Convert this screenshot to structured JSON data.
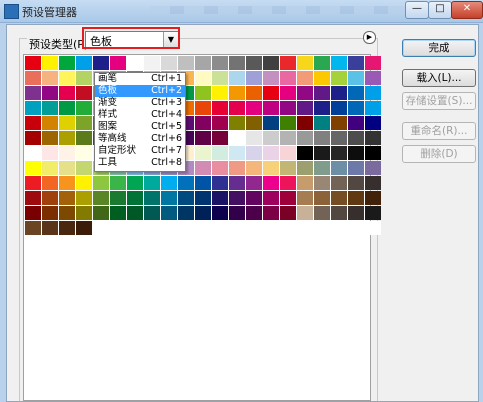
{
  "window": {
    "title": "预设管理器"
  },
  "group": {
    "label": "预设类型(P):"
  },
  "type_select": {
    "value": "色板"
  },
  "dropdown": {
    "items": [
      {
        "label": "画笔",
        "shortcut": "Ctrl+1"
      },
      {
        "label": "色板",
        "shortcut": "Ctrl+2",
        "selected": true
      },
      {
        "label": "渐变",
        "shortcut": "Ctrl+3"
      },
      {
        "label": "样式",
        "shortcut": "Ctrl+4"
      },
      {
        "label": "图案",
        "shortcut": "Ctrl+5"
      },
      {
        "label": "等高线",
        "shortcut": "Ctrl+6"
      },
      {
        "label": "自定形状",
        "shortcut": "Ctrl+7"
      },
      {
        "label": "工具",
        "shortcut": "Ctrl+8"
      }
    ]
  },
  "buttons": {
    "done": "完成",
    "load": "载入(L)...",
    "save": "存储设置(S)...",
    "rename": "重命名(R)...",
    "delete": "删除(D)"
  },
  "swatches": [
    "#e60012",
    "#fff100",
    "#00a73c",
    "#00a0e9",
    "#1d2088",
    "#e4007f",
    "#ffffff",
    "#f2f2f2",
    "#d9d9d9",
    "#bfbfbf",
    "#a6a6a6",
    "#8c8c8c",
    "#737373",
    "#595959",
    "#404040",
    "#e8282b",
    "#f7d71c",
    "#29a851",
    "#00b7ee",
    "#3b3f9c",
    "#e61673",
    "#ea6f5a",
    "#f6b37f",
    "#fff45c",
    "#b3d465",
    "#7ecef4",
    "#8c97cb",
    "#ae5da1",
    "#f19ec2",
    "#f19149",
    "#f8b551",
    "#fffac2",
    "#cce198",
    "#acd6ec",
    "#a0a0d8",
    "#c490bf",
    "#ea68a2",
    "#f29b76",
    "#fcc800",
    "#a5d13a",
    "#5bc2e7",
    "#9b59b6",
    "#7e318e",
    "#920783",
    "#e5004f",
    "#c30d23",
    "#b28850",
    "#8f8f8f",
    "#2e3192",
    "#0068b7",
    "#00a0c1",
    "#009944",
    "#8fc31f",
    "#fff100",
    "#f39800",
    "#eb6100",
    "#e60012",
    "#e4007f",
    "#920783",
    "#601986",
    "#1d2088",
    "#0068b7",
    "#00a0e9",
    "#00a0c1",
    "#009e96",
    "#009944",
    "#22ac38",
    "#8fc31f",
    "#cfdb00",
    "#fff100",
    "#f8b62d",
    "#f39800",
    "#ed6d00",
    "#e94709",
    "#e60033",
    "#e5004f",
    "#e4007f",
    "#be0081",
    "#920783",
    "#601986",
    "#1d2088",
    "#004098",
    "#0068b7",
    "#00a0e9",
    "#c7000b",
    "#d28300",
    "#dfd000",
    "#7ba428",
    "#00913a",
    "#008b84",
    "#0086ae",
    "#00479d",
    "#1b1464",
    "#5e0c73",
    "#810060",
    "#a1004e",
    "#808000",
    "#806000",
    "#004080",
    "#408000",
    "#800000",
    "#008080",
    "#804000",
    "#400080",
    "#000080",
    "#a40000",
    "#9d6500",
    "#aba000",
    "#5b7b1a",
    "#006d2c",
    "#006763",
    "#006482",
    "#003375",
    "#0d0a45",
    "#470456",
    "#600046",
    "#780038",
    "#ffffff",
    "#e6e6e6",
    "#cccccc",
    "#b3b3b3",
    "#999999",
    "#808080",
    "#666666",
    "#4d4d4d",
    "#333333",
    "#ffffff",
    "#ffe6e6",
    "#fff2e6",
    "#ffffe6",
    "#e6ffe6",
    "#e6ffff",
    "#e6e6ff",
    "#ffe6ff",
    "#fde2c3",
    "#fcf0ce",
    "#eaf4cf",
    "#d2ecdf",
    "#d0e8f1",
    "#d7d3ea",
    "#ead2e7",
    "#f6d4d8",
    "#000000",
    "#1a1a1a",
    "#262626",
    "#0d0d0d",
    "#000000",
    "#ffff00",
    "#f1ed6a",
    "#e5e089",
    "#c4d66f",
    "#a4cc6b",
    "#8bc4ad",
    "#85bde3",
    "#8ba5d6",
    "#9a8fc6",
    "#b18bc1",
    "#d28cb4",
    "#e88ea0",
    "#ee9a85",
    "#f4b67b",
    "#f7d07a",
    "#c3b574",
    "#9ca06f",
    "#7f9c8c",
    "#6d8fa5",
    "#6d79a8",
    "#7a6a9e",
    "#ed1c24",
    "#f26522",
    "#f7941d",
    "#fff200",
    "#8dc63f",
    "#39b54a",
    "#00a651",
    "#00a99d",
    "#00aeef",
    "#0072bc",
    "#0054a6",
    "#2e3192",
    "#662d91",
    "#92278f",
    "#ec008c",
    "#ed145b",
    "#c69c6d",
    "#998675",
    "#736357",
    "#534741",
    "#362f2d",
    "#9e0b0f",
    "#a0410d",
    "#a36209",
    "#aba000",
    "#598527",
    "#1a7b30",
    "#007236",
    "#00746b",
    "#0076a3",
    "#004a80",
    "#003471",
    "#1b1464",
    "#440e62",
    "#630460",
    "#9e005d",
    "#9e0039",
    "#a67c52",
    "#8c6239",
    "#754c24",
    "#603913",
    "#42210b",
    "#790000",
    "#7b2e00",
    "#7d4900",
    "#827b00",
    "#406618",
    "#005e20",
    "#005826",
    "#005952",
    "#005b7f",
    "#003663",
    "#002157",
    "#0d004c",
    "#32004b",
    "#4b0049",
    "#7b0046",
    "#7a0026",
    "#c7b299",
    "#736357",
    "#534741",
    "#362f2d",
    "#1a1a1a",
    "#6b4423",
    "#5a3418",
    "#4a2810",
    "#3a1c08",
    "#ffffff",
    "#ffffff",
    "#ffffff",
    "#ffffff",
    "#ffffff",
    "#ffffff",
    "#ffffff",
    "#ffffff",
    "#ffffff",
    "#ffffff",
    "#ffffff",
    "#ffffff",
    "#ffffff",
    "#ffffff",
    "#ffffff",
    "#ffffff",
    "#ffffff"
  ]
}
